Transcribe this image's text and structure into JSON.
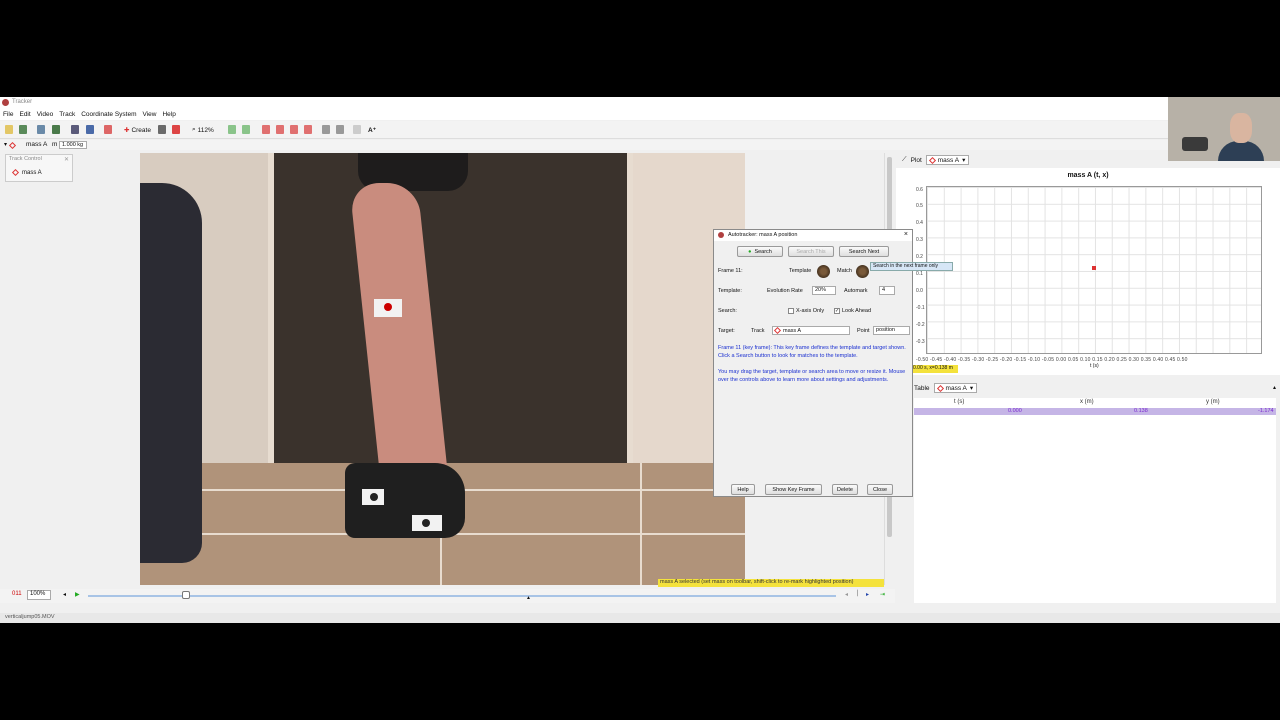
{
  "window": {
    "title": "Tracker"
  },
  "menu": [
    "File",
    "Edit",
    "Video",
    "Track",
    "Coordinate System",
    "View",
    "Help"
  ],
  "toolbar": {
    "create_label": "Create",
    "zoom_label": "112%"
  },
  "trackbar": {
    "track_name": "mass A",
    "mass_label": "m",
    "mass_value": "1.000 kg"
  },
  "track_control": {
    "title": "Track Control",
    "track_button": "mass A"
  },
  "video_status": "mass A selected (set mass on toolbar, shift-click to re-mark highlighted position)",
  "player": {
    "frame": "011",
    "zoom": "100%"
  },
  "statusbar": {
    "filename": "verticaljump05.MOV"
  },
  "plot": {
    "tab_label": "Plot",
    "track": "mass A",
    "title": "mass A (t, x)",
    "y_ticks": [
      "0.6",
      "0.5",
      "0.4",
      "0.3",
      "0.2",
      "0.1",
      "0.0",
      "-0.1",
      "-0.2",
      "-0.3"
    ],
    "x_ticks": "-0.50 -0.45 -0.40 -0.35 -0.30 -0.25 -0.20 -0.15 -0.10 -0.05 0.00 0.05 0.10 0.15 0.20 0.25 0.30 0.35 0.40 0.45 0.50",
    "x_axis": "t (s)",
    "readout": "0.00 s, x=0.138 m",
    "point": {
      "t": 0.0,
      "x": 0.138
    }
  },
  "table": {
    "tab_label": "Table",
    "track": "mass A",
    "columns": [
      "t (s)",
      "x (m)",
      "y (m)"
    ],
    "rows": [
      [
        "0.000",
        "0.138",
        "-1.174"
      ]
    ]
  },
  "autotracker": {
    "title": "Autotracker: mass A position",
    "search_button": "Search",
    "search_this_button": "Search This",
    "search_next_button": "Search Next",
    "tooltip": "Search in the next frame only",
    "frame_label": "Frame 11:",
    "template_label": "Template",
    "match_label": "Match",
    "template_row_label": "Template:",
    "evolution_rate_label": "Evolution Rate",
    "evolution_rate_value": "20%",
    "automark_label": "Automark",
    "automark_value": "4",
    "search_row_label": "Search:",
    "x_axis_only_label": "X-axis Only",
    "look_ahead_label": "Look Ahead",
    "target_row_label": "Target:",
    "track_label": "Track",
    "track_value": "mass A",
    "point_label": "Point",
    "point_value": "position",
    "message_1": "Frame 11 (key frame): This key frame defines the template and target shown. Click a Search button to look for matches to the template.",
    "message_2": "You may drag the target, template or search area to move or resize it. Mouse over the controls above to learn more about settings and adjustments.",
    "help_button": "Help",
    "show_key_frame_button": "Show Key Frame",
    "delete_button": "Delete",
    "close_button": "Close"
  },
  "colors": {
    "accent": "#d33333",
    "highlight": "#f4e23c",
    "selection": "#c5b5e6",
    "message": "#1a2fd0"
  }
}
